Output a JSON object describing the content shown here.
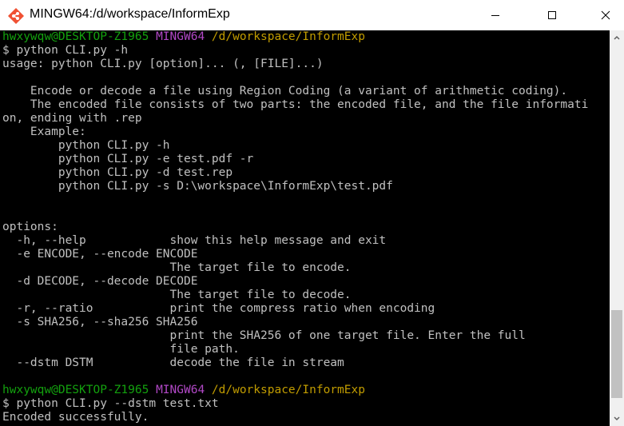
{
  "window": {
    "title": "MINGW64:/d/workspace/InformExp",
    "app_icon": "git-bash-icon",
    "buttons": {
      "minimize": "minimize-icon",
      "maximize": "maximize-icon",
      "close": "close-icon"
    }
  },
  "colors": {
    "user": "#13a10e",
    "shell": "#b148c6",
    "path": "#c19c00",
    "text": "#c0c0c0",
    "background": "#000000"
  },
  "terminal": {
    "prompt1": {
      "user": "hwxywqw@DESKTOP-Z1965",
      "shell": "MINGW64",
      "path": "/d/workspace/InformExp"
    },
    "cmd1": "$ python CLI.py -h",
    "help_lines": [
      "usage: python CLI.py [option]... (, [FILE]...)",
      "",
      "    Encode or decode a file using Region Coding (a variant of arithmetic coding).",
      "    The encoded file consists of two parts: the encoded file, and the file informati",
      "on, ending with .rep",
      "    Example:",
      "        python CLI.py -h",
      "        python CLI.py -e test.pdf -r",
      "        python CLI.py -d test.rep",
      "        python CLI.py -s D:\\workspace\\InformExp\\test.pdf",
      "",
      "",
      "options:",
      "  -h, --help            show this help message and exit",
      "  -e ENCODE, --encode ENCODE",
      "                        The target file to encode.",
      "  -d DECODE, --decode DECODE",
      "                        The target file to decode.",
      "  -r, --ratio           print the compress ratio when encoding",
      "  -s SHA256, --sha256 SHA256",
      "                        print the SHA256 of one target file. Enter the full",
      "                        file path.",
      "  --dstm DSTM           decode the file in stream",
      ""
    ],
    "prompt2": {
      "user": "hwxywqw@DESKTOP-Z1965",
      "shell": "MINGW64",
      "path": "/d/workspace/InformExp"
    },
    "cmd2": "$ python CLI.py --dstm test.txt",
    "output": "Encoded successfully."
  },
  "scrollbar": {
    "up": "scroll-up-arrow-icon",
    "down": "scroll-down-arrow-icon"
  }
}
